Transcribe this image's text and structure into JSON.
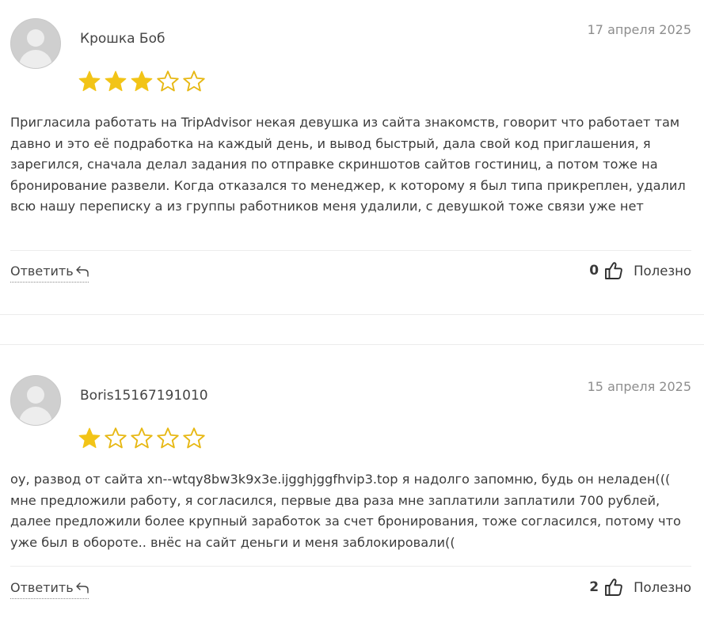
{
  "colors": {
    "star_fill": "#f2c417",
    "star_outline": "#e7b814",
    "avatar_bg": "#cfcfcf"
  },
  "icons": {
    "reply": "reply-arrow-icon",
    "like": "thumbs-up-icon",
    "avatar": "default-user-avatar-icon"
  },
  "reviews": [
    {
      "author": "Крошка Боб",
      "date": "17 апреля 2025",
      "rating": 3,
      "max_rating": 5,
      "text": "Пригласила работать на TripAdvisor некая девушка из сайта знакомств, говорит что работает там давно и это её подработка на каждый день, и вывод быстрый, дала свой код приглашения, я зарегился, сначала делал задания по отправке скриншотов сайтов гостиниц, а потом тоже на бронирование развели. Когда отказался то менеджер, к которому я был типа прикреплен, удалил всю нашу переписку а из группы работников меня удалили, с девушкой тоже связи уже нет",
      "reply_label": "Ответить",
      "likes": "0",
      "useful_label": "Полезно"
    },
    {
      "author": "Boris15167191010",
      "date": "15 апреля 2025",
      "rating": 1,
      "max_rating": 5,
      "text": "оу, развод от сайта xn--wtqy8bw3k9x3e.ijgghjggfhvip3.top я надолго запомню, будь он неладен((( мне предложили работу, я согласился, первые два раза мне заплатили заплатили 700 рублей, далее предложили более крупный заработок за счет бронирования, тоже согласился, потому что уже был в обороте.. внёс на сайт деньги и меня заблокировали((",
      "reply_label": "Ответить",
      "likes": "2",
      "useful_label": "Полезно"
    }
  ]
}
